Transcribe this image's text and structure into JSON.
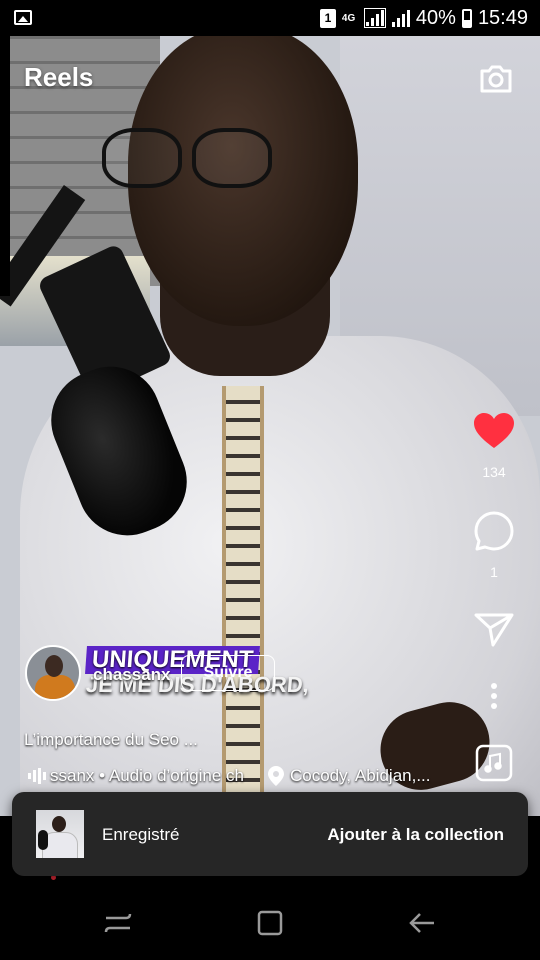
{
  "status_bar": {
    "sim_slot": "1",
    "network": "4G",
    "battery_percent": "40%",
    "time": "15:49"
  },
  "header": {
    "title": "Reels"
  },
  "video_caption": {
    "line1": "UNIQUEMENT",
    "line2": "JE ME DIS D'ABORD,"
  },
  "actions": {
    "like_count": "134",
    "comment_count": "1"
  },
  "reel": {
    "username": "chassanx",
    "follow_label": "Suivre",
    "caption": "L’importance du Seo ...",
    "audio_text": "ssanx • Audio d’origine   ch",
    "location": "Cocody, Abidjan,..."
  },
  "toast": {
    "label": "Enregistré",
    "action": "Ajouter à la collection"
  },
  "colors": {
    "like_red": "#ff3040",
    "caption_purple": "#5b24c7",
    "toast_bg": "#262626"
  },
  "icons": {
    "camera": "camera-icon",
    "like": "heart-icon",
    "comment": "comment-icon",
    "share": "send-icon",
    "more": "more-vertical-icon",
    "audio": "music-note-icon"
  }
}
